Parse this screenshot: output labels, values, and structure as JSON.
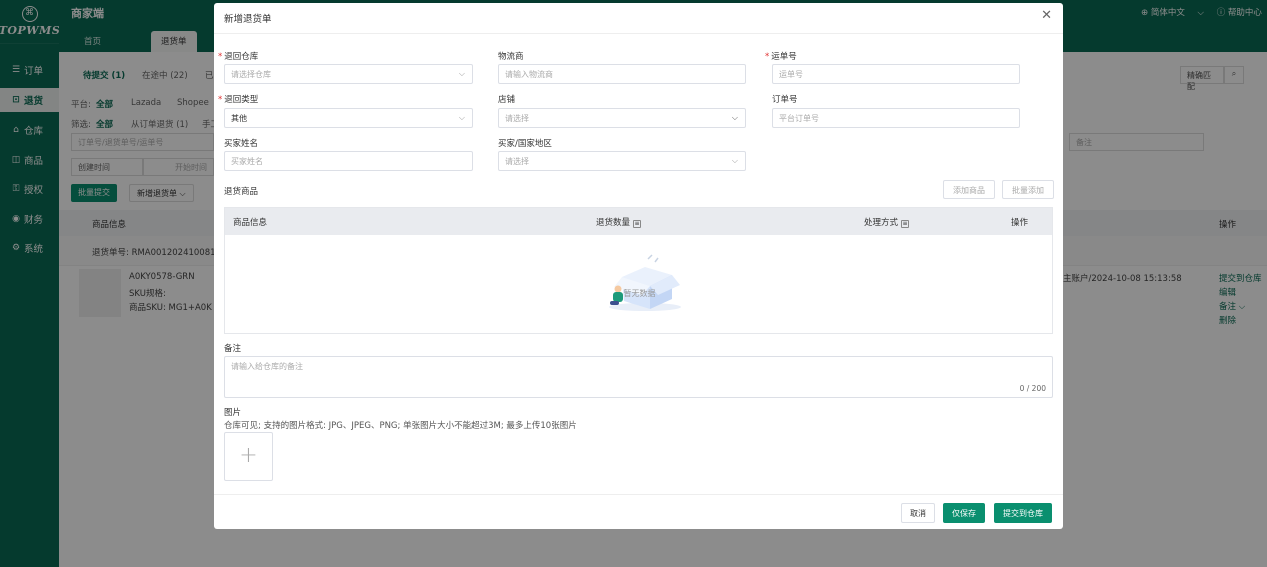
{
  "sidebar": {
    "logo_text": "TOPWMS",
    "items": [
      {
        "label": "订单",
        "icon": "list-icon"
      },
      {
        "label": "退货",
        "icon": "return-icon"
      },
      {
        "label": "仓库",
        "icon": "warehouse-icon"
      },
      {
        "label": "商品",
        "icon": "box-icon"
      },
      {
        "label": "授权",
        "icon": "key-icon"
      },
      {
        "label": "财务",
        "icon": "money-icon"
      },
      {
        "label": "系统",
        "icon": "gear-icon"
      }
    ]
  },
  "header": {
    "title": "商家端",
    "language": "简体中文",
    "help": "帮助中心",
    "badge": "①"
  },
  "tabs": [
    {
      "label": "首页"
    },
    {
      "label": "退货单"
    }
  ],
  "background": {
    "status_tabs": [
      "待提交 (1)",
      "在途中 (22)",
      "已"
    ],
    "platform_label": "平台:",
    "platform_values": [
      "全部",
      "Lazada",
      "Shopee"
    ],
    "filter_label": "筛选:",
    "filter_values": [
      "全部",
      "从订单退货 (1)",
      "手工"
    ],
    "search_placeholder": "订单号/退货单号/运单号",
    "created_time": "创建时间",
    "start_time": "开始时间",
    "remark_placeholder": "备注",
    "match_mode": "精确匹配",
    "batch_submit": "批量提交",
    "new_return": "新增退货单",
    "col_product_info": "商品信息",
    "col_actions": "操作",
    "return_no": "退货单号: RMA001202410081",
    "product_name": "A0KY0578-GRN",
    "sku_spec": "SKU规格:",
    "product_sku": "商品SKU: MG1+A0K",
    "creator_time": "主账户/2024-10-08 15:13:58",
    "actions": [
      "提交到仓库",
      "编辑",
      "备注 ⌵",
      "删除"
    ]
  },
  "modal": {
    "title": "新增退货单",
    "fields": {
      "return_warehouse": {
        "label": "退回仓库",
        "placeholder": "请选择仓库"
      },
      "logistics": {
        "label": "物流商",
        "placeholder": "请输入物流商"
      },
      "tracking_no": {
        "label": "运单号",
        "placeholder": "运单号"
      },
      "return_type": {
        "label": "退回类型",
        "value": "其他"
      },
      "store": {
        "label": "店铺",
        "placeholder": "请选择"
      },
      "order_no": {
        "label": "订单号",
        "placeholder": "平台订单号"
      },
      "buyer_name": {
        "label": "买家姓名",
        "placeholder": "买家姓名"
      },
      "buyer_region": {
        "label": "买家/国家地区",
        "placeholder": "请选择"
      }
    },
    "return_goods_label": "退货商品",
    "add_product": "添加商品",
    "batch_add": "批量添加",
    "table": {
      "columns": [
        "商品信息",
        "退货数量",
        "处理方式",
        "操作"
      ],
      "empty_text": "暂无数据"
    },
    "remark": {
      "label": "备注",
      "placeholder": "请输入给仓库的备注",
      "counter": "0 / 200"
    },
    "images": {
      "label": "图片",
      "hint": "仓库可见; 支持的图片格式: JPG、JPEG、PNG; 单张图片大小不能超过3M; 最多上传10张图片"
    },
    "buttons": {
      "cancel": "取消",
      "save_only": "仅保存",
      "submit": "提交到仓库"
    }
  }
}
